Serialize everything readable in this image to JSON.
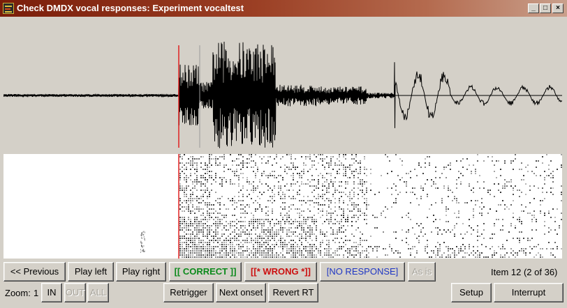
{
  "window": {
    "title": "Check DMDX vocal responses: Experiment vocaltest",
    "controls": {
      "minimize": "_",
      "maximize": "□",
      "close": "×"
    }
  },
  "stimulus": {
    "word": "pint"
  },
  "colors": {
    "title_bar": "#7a1d0a",
    "word": "#1010d0",
    "onset_marker": "#e02020",
    "correct": "#0b8a1b",
    "wrong": "#cc0f0f",
    "no_response": "#1f36c4"
  },
  "controls_row1": {
    "previous": "<< Previous",
    "play_left": "Play left",
    "play_right": "Play right",
    "correct": "[[ CORRECT ]]",
    "wrong": "[[* WRONG *]]",
    "no_response": "[NO RESPONSE]",
    "as_is": "As is",
    "item_status": "Item 12 (2 of 36)"
  },
  "controls_row2": {
    "zoom_label": "Zoom:",
    "zoom_level": "1",
    "zoom_in": "IN",
    "zoom_out": "OUT",
    "zoom_all": "ALL",
    "retrigger": "Retrigger",
    "next_onset": "Next onset",
    "revert_rt": "Revert RT",
    "setup": "Setup",
    "interrupt": "Interrupt"
  }
}
